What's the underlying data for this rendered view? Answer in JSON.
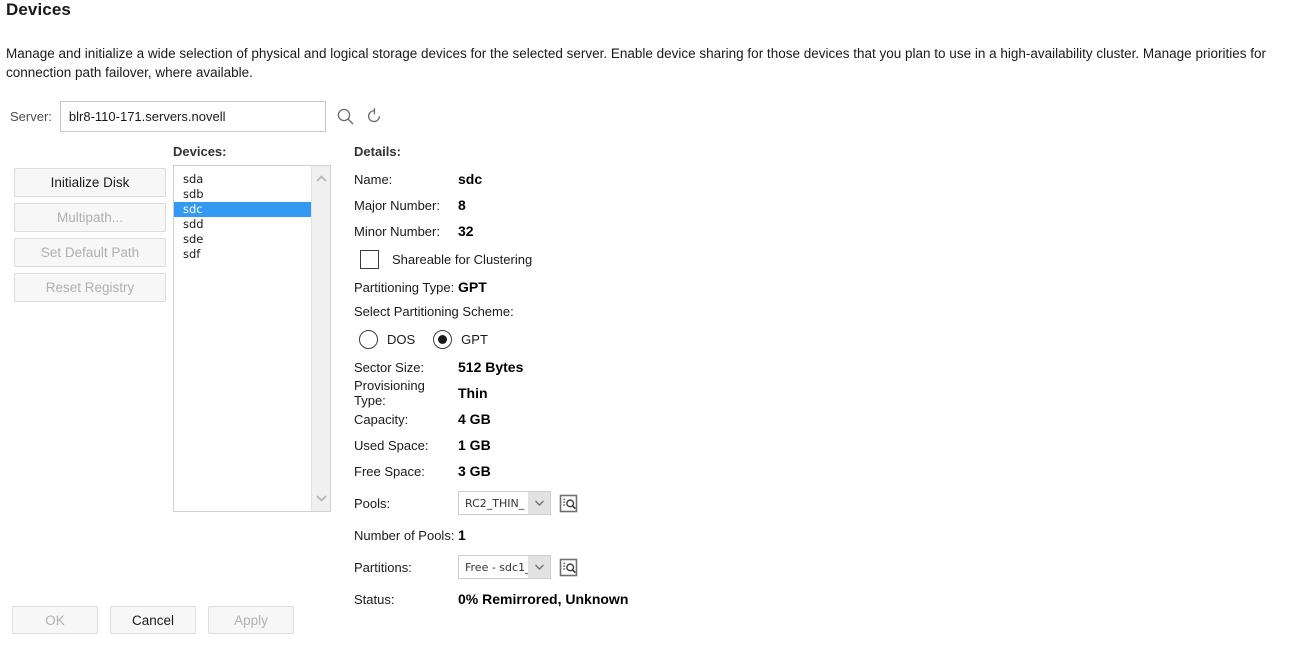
{
  "page": {
    "title": "Devices",
    "description": "Manage and initialize a wide selection of physical and logical storage devices for the selected server. Enable device sharing for those devices that you plan to use in a high-availability cluster. Manage priorities for connection path failover, where available."
  },
  "server": {
    "label": "Server:",
    "value": "blr8-110-171.servers.novell",
    "placeholder": "",
    "search_icon": "search-icon",
    "refresh_icon": "refresh-icon"
  },
  "actions": [
    {
      "label": "Initialize Disk",
      "disabled": false
    },
    {
      "label": "Multipath...",
      "disabled": true
    },
    {
      "label": "Set Default Path",
      "disabled": true
    },
    {
      "label": "Reset Registry",
      "disabled": true
    }
  ],
  "devices": {
    "label": "Devices:",
    "items": [
      "sda",
      "sdb",
      "sdc",
      "sdd",
      "sde",
      "sdf"
    ],
    "selected": "sdc",
    "selected_color": "#3399f3"
  },
  "details": {
    "label": "Details:",
    "name_key": "Name:",
    "name_value": "sdc",
    "major_key": "Major Number:",
    "major_value": "8",
    "minor_key": "Minor Number:",
    "minor_value": "32",
    "shareable_label": "Shareable for Clustering",
    "shareable_checked": false,
    "partitioning_type_key": "Partitioning Type:",
    "partitioning_type_value": "GPT",
    "scheme_label": "Select Partitioning Scheme:",
    "scheme_options": [
      "DOS",
      "GPT"
    ],
    "scheme_selected": "GPT",
    "sector_size_key": "Sector Size:",
    "sector_size_value": "512 Bytes",
    "provisioning_key": "Provisioning Type:",
    "provisioning_value": "Thin",
    "capacity_key": "Capacity:",
    "capacity_value": "4 GB",
    "used_space_key": "Used Space:",
    "used_space_value": "1 GB",
    "free_space_key": "Free Space:",
    "free_space_value": "3 GB",
    "pools_key": "Pools:",
    "pools_value": "RC2_THIN_",
    "number_of_pools_key": "Number of Pools:",
    "number_of_pools_value": "1",
    "partitions_key": "Partitions:",
    "partitions_value": "Free - sdc1_",
    "status_key": "Status:",
    "status_value": "0% Remirrored, Unknown",
    "inspect_icon": "inspect-list-icon",
    "dropdown_icon": "chevron-down-icon"
  },
  "footer": [
    {
      "label": "OK",
      "disabled": true
    },
    {
      "label": "Cancel",
      "disabled": false
    },
    {
      "label": "Apply",
      "disabled": true
    }
  ]
}
